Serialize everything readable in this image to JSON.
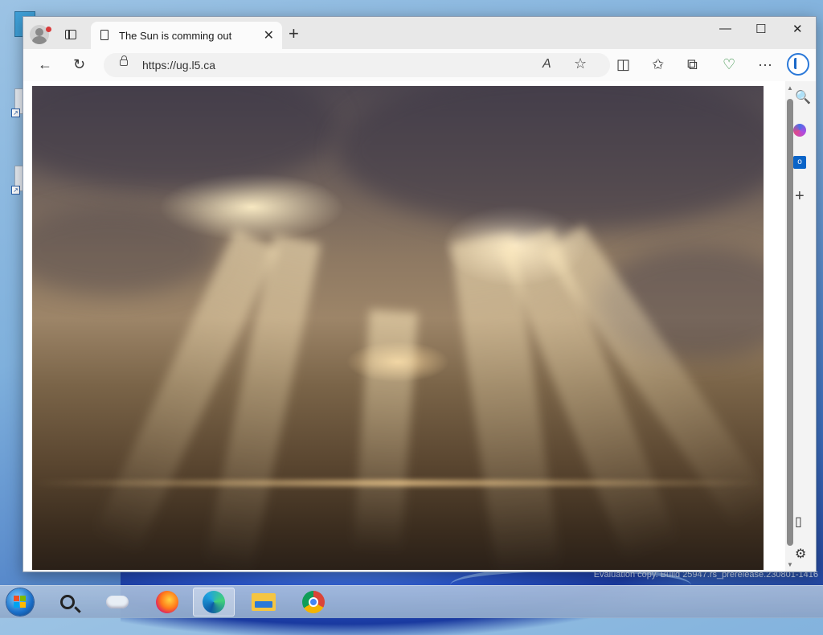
{
  "tab": {
    "title": "The Sun is comming out"
  },
  "address": {
    "url": "https://ug.l5.ca"
  },
  "icons": {
    "back": "←",
    "refresh": "↻",
    "read_aloud": "A",
    "favorite": "☆",
    "split": "◫",
    "favorites": "✩",
    "collections": "⧉",
    "health": "♡",
    "more": "···",
    "search": "🔍",
    "add": "+",
    "sidebar_toggle": "▯",
    "settings": "⚙",
    "tab_close": "✕",
    "new_tab": "+",
    "minimize": "—",
    "maximize": "☐",
    "close": "✕"
  },
  "desktop": {
    "evaluation": "Evaluation copy. Build 25947.rs_prerelease.230801-1416"
  }
}
